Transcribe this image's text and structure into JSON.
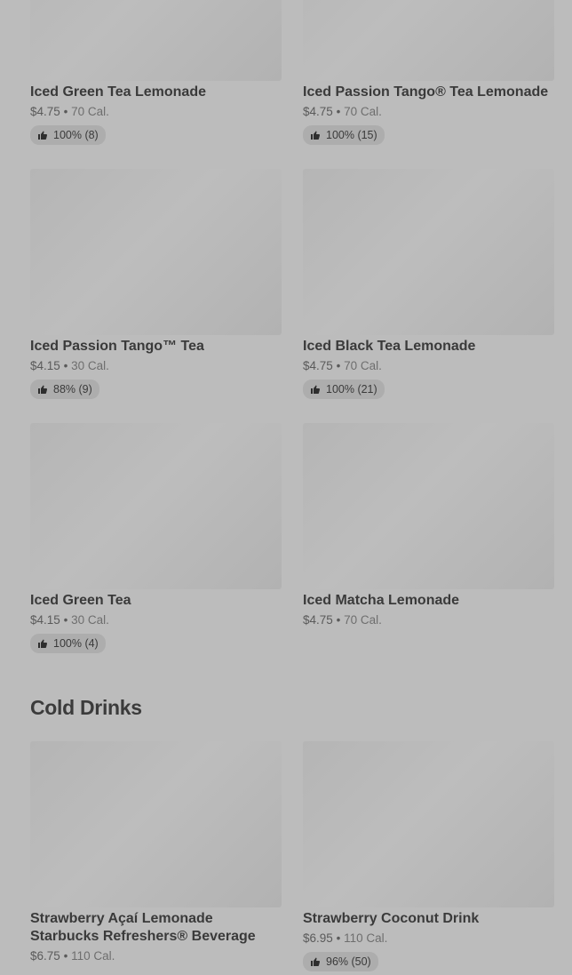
{
  "sections": [
    {
      "title": "",
      "items": [
        {
          "name": "Iced Green Tea Lemonade",
          "price": "$4.75",
          "cal": "70 Cal.",
          "rating": "100% (8)"
        },
        {
          "name": "Iced Passion Tango® Tea Lemonade",
          "price": "$4.75",
          "cal": "70 Cal.",
          "rating": "100% (15)"
        },
        {
          "name": "Iced Passion Tango™ Tea",
          "price": "$4.15",
          "cal": "30 Cal.",
          "rating": "88% (9)"
        },
        {
          "name": "Iced Black Tea Lemonade",
          "price": "$4.75",
          "cal": "70 Cal.",
          "rating": "100% (21)"
        },
        {
          "name": "Iced Green Tea",
          "price": "$4.15",
          "cal": "30 Cal.",
          "rating": "100% (4)"
        },
        {
          "name": "Iced Matcha Lemonade",
          "price": "$4.75",
          "cal": "70 Cal."
        }
      ]
    },
    {
      "title": "Cold Drinks",
      "items": [
        {
          "name": "Strawberry Açaí Lemonade Starbucks Refreshers® Beverage",
          "price": "$6.75",
          "cal": "110 Cal."
        },
        {
          "name": "Strawberry Coconut Drink",
          "price": "$6.95",
          "cal": "110 Cal.",
          "rating": "96% (50)"
        }
      ]
    }
  ],
  "icons": {
    "rating": "thumbs-up-icon"
  },
  "separator": "•"
}
